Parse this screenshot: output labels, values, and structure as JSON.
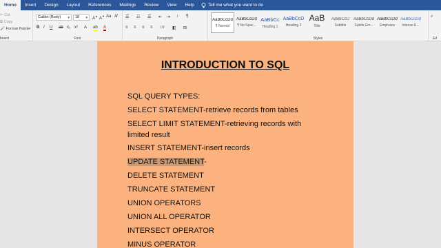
{
  "tabs": [
    "Home",
    "Insert",
    "Design",
    "Layout",
    "References",
    "Mailings",
    "Review",
    "View",
    "Help"
  ],
  "tell_me": "Tell me what you want to do",
  "clipboard": {
    "cut": "Cut",
    "copy": "Copy",
    "format_painter": "Format Painter",
    "label": "board"
  },
  "font": {
    "name": "Calibri (Body)",
    "size": "18",
    "label": "Font"
  },
  "paragraph": {
    "label": "Paragraph"
  },
  "styles": {
    "label": "Styles",
    "items": [
      {
        "sample": "AaBbCcDd",
        "name": "¶ Normal"
      },
      {
        "sample": "AaBbCcDd",
        "name": "¶ No Spac..."
      },
      {
        "sample": "AaBbCc",
        "name": "Heading 1"
      },
      {
        "sample": "AaBbCcD",
        "name": "Heading 2"
      },
      {
        "sample": "AaB",
        "name": "Title"
      },
      {
        "sample": "AaBbCcD",
        "name": "Subtitle"
      },
      {
        "sample": "AaBbCcDd",
        "name": "Subtle Em..."
      },
      {
        "sample": "AaBbCcDd",
        "name": "Emphasis"
      },
      {
        "sample": "AaBbCcDd",
        "name": "Intense E..."
      }
    ]
  },
  "editing_label": "Ed",
  "document": {
    "title": "INTRODUCTION TO SQL",
    "lines": [
      "SQL QUERY TYPES:",
      "SELECT STATEMENT-retrieve records from tables",
      "SELECT LIMIT STATEMENT-retrieving records with limited result",
      "INSERT STATEMENT-insert records",
      "UPDATE STATEMENT",
      "DELETE STATEMENT",
      "TRUNCATE STATEMENT",
      "UNION OPERATORS",
      "UNION ALL OPERATOR",
      "INTERSECT OPERATOR",
      "MINUS OPERATOR"
    ],
    "update_suffix": "-"
  },
  "colors": {
    "ribbon_tab_bar": "#2b579a",
    "page_background": "#fbb27e",
    "selection_highlight": "#c99a76"
  }
}
